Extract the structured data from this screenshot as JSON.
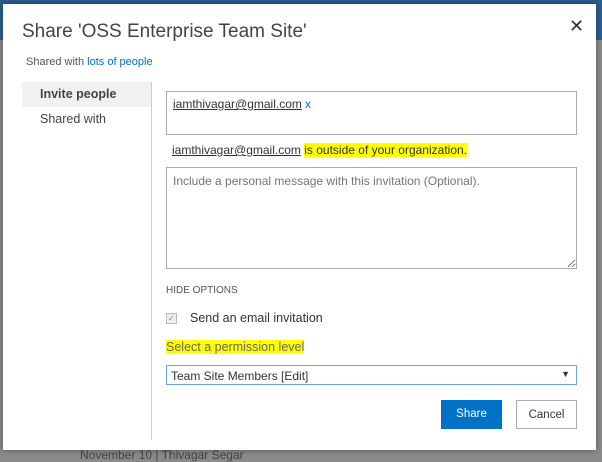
{
  "background": {
    "footer_text": "November 10  |  Thivagar Segar"
  },
  "dialog": {
    "title": "Share 'OSS Enterprise Team Site'",
    "close_icon": "close-icon",
    "shared_prefix": "Shared with",
    "shared_link": "lots of people",
    "nav": [
      {
        "label": "Invite people"
      },
      {
        "label": "Shared with"
      }
    ],
    "invitee": "iamthivagar@gmail.com",
    "remove_label": "x",
    "warning_email": "iamthivagar@gmail.com",
    "warning_text": "is outside of your organization.",
    "message_placeholder": "Include a personal message with this invitation (Optional).",
    "hide_options": "HIDE OPTIONS",
    "send_email_label": "Send an email invitation",
    "permission_label": "Select a permission level",
    "permission_value": "Team Site Members [Edit]",
    "share_label": "Share",
    "cancel_label": "Cancel"
  }
}
